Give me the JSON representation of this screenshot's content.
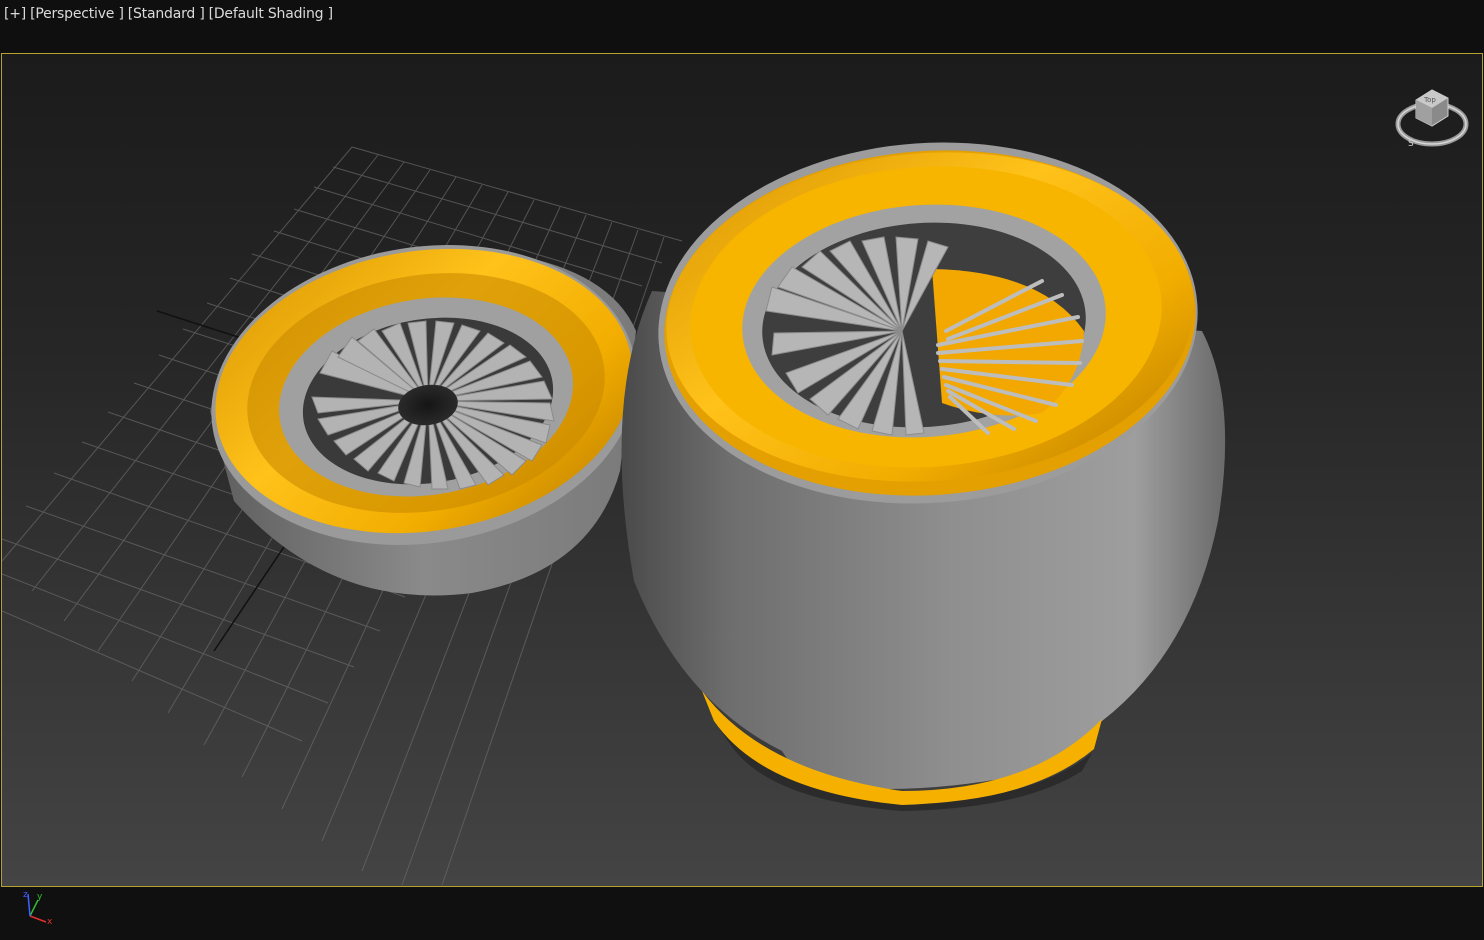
{
  "viewport": {
    "labels": [
      "[+]",
      "[Perspective ]",
      "[Standard ]",
      "[Default Shading ]"
    ]
  },
  "viewcube": {
    "face_label": "Top",
    "compass_south": "S"
  },
  "axis_tripod": {
    "x": "x",
    "y": "y",
    "z": "z"
  },
  "colors": {
    "frame_border": "#b5a12e",
    "rim_accent": "#f5b000",
    "body_gray": "#9a9a9a",
    "grid": "#6a6a6a"
  }
}
